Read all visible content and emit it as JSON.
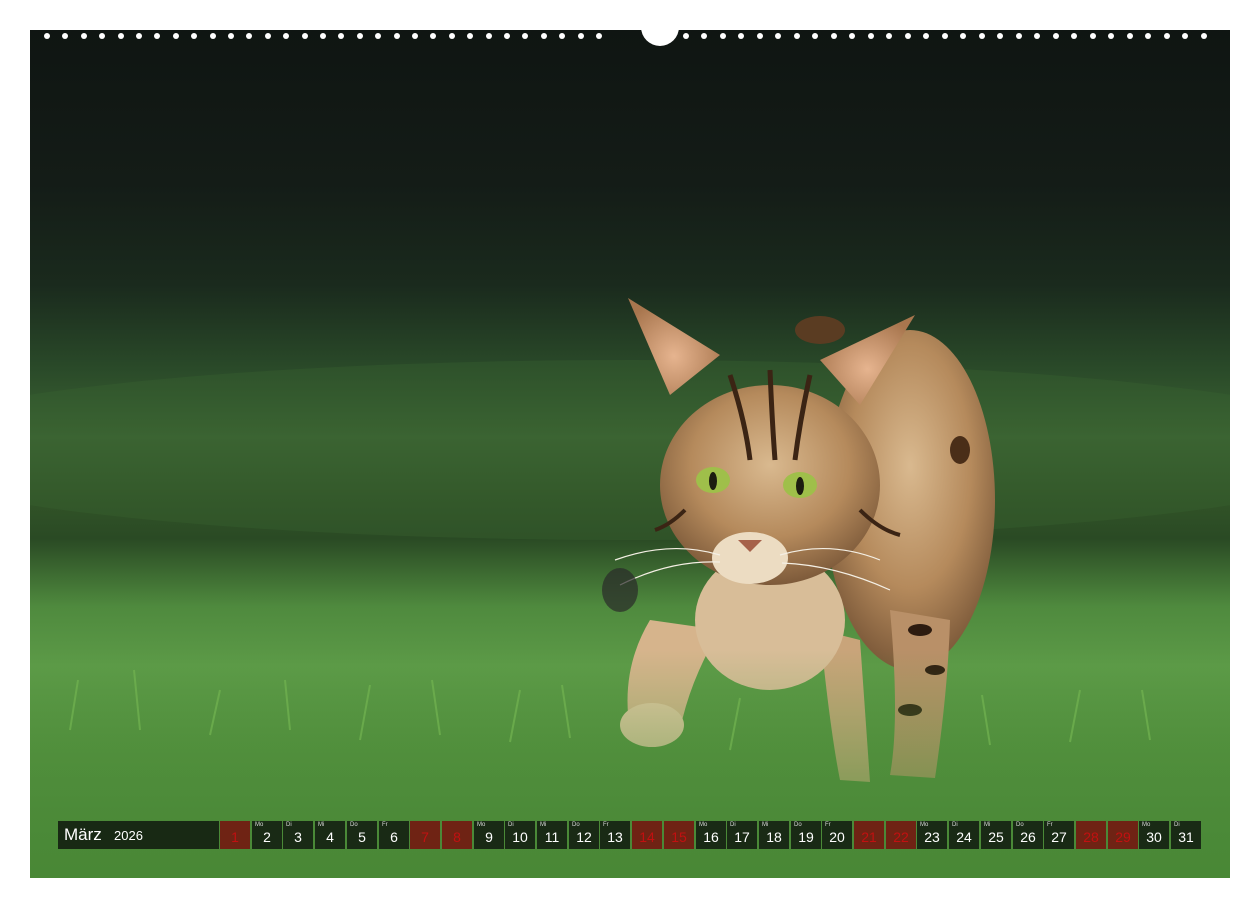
{
  "calendar": {
    "month": "März",
    "year": "2026",
    "days": [
      {
        "num": "1",
        "weekday": "",
        "weekend": true
      },
      {
        "num": "2",
        "weekday": "Mo",
        "weekend": false
      },
      {
        "num": "3",
        "weekday": "Di",
        "weekend": false
      },
      {
        "num": "4",
        "weekday": "Mi",
        "weekend": false
      },
      {
        "num": "5",
        "weekday": "Do",
        "weekend": false
      },
      {
        "num": "6",
        "weekday": "Fr",
        "weekend": false
      },
      {
        "num": "7",
        "weekday": "",
        "weekend": true
      },
      {
        "num": "8",
        "weekday": "",
        "weekend": true
      },
      {
        "num": "9",
        "weekday": "Mo",
        "weekend": false
      },
      {
        "num": "10",
        "weekday": "Di",
        "weekend": false
      },
      {
        "num": "11",
        "weekday": "Mi",
        "weekend": false
      },
      {
        "num": "12",
        "weekday": "Do",
        "weekend": false
      },
      {
        "num": "13",
        "weekday": "Fr",
        "weekend": false
      },
      {
        "num": "14",
        "weekday": "",
        "weekend": true
      },
      {
        "num": "15",
        "weekday": "",
        "weekend": true
      },
      {
        "num": "16",
        "weekday": "Mo",
        "weekend": false
      },
      {
        "num": "17",
        "weekday": "Di",
        "weekend": false
      },
      {
        "num": "18",
        "weekday": "Mi",
        "weekend": false
      },
      {
        "num": "19",
        "weekday": "Do",
        "weekend": false
      },
      {
        "num": "20",
        "weekday": "Fr",
        "weekend": false
      },
      {
        "num": "21",
        "weekday": "",
        "weekend": true
      },
      {
        "num": "22",
        "weekday": "",
        "weekend": true
      },
      {
        "num": "23",
        "weekday": "Mo",
        "weekend": false
      },
      {
        "num": "24",
        "weekday": "Di",
        "weekend": false
      },
      {
        "num": "25",
        "weekday": "Mi",
        "weekend": false
      },
      {
        "num": "26",
        "weekday": "Do",
        "weekend": false
      },
      {
        "num": "27",
        "weekday": "Fr",
        "weekend": false
      },
      {
        "num": "28",
        "weekday": "",
        "weekend": true
      },
      {
        "num": "29",
        "weekday": "",
        "weekend": true
      },
      {
        "num": "30",
        "weekday": "Mo",
        "weekend": false
      },
      {
        "num": "31",
        "weekday": "Di",
        "weekend": false
      }
    ]
  },
  "colors": {
    "weekend_number": "#c21010",
    "strip_background": "#0a0e0a"
  }
}
